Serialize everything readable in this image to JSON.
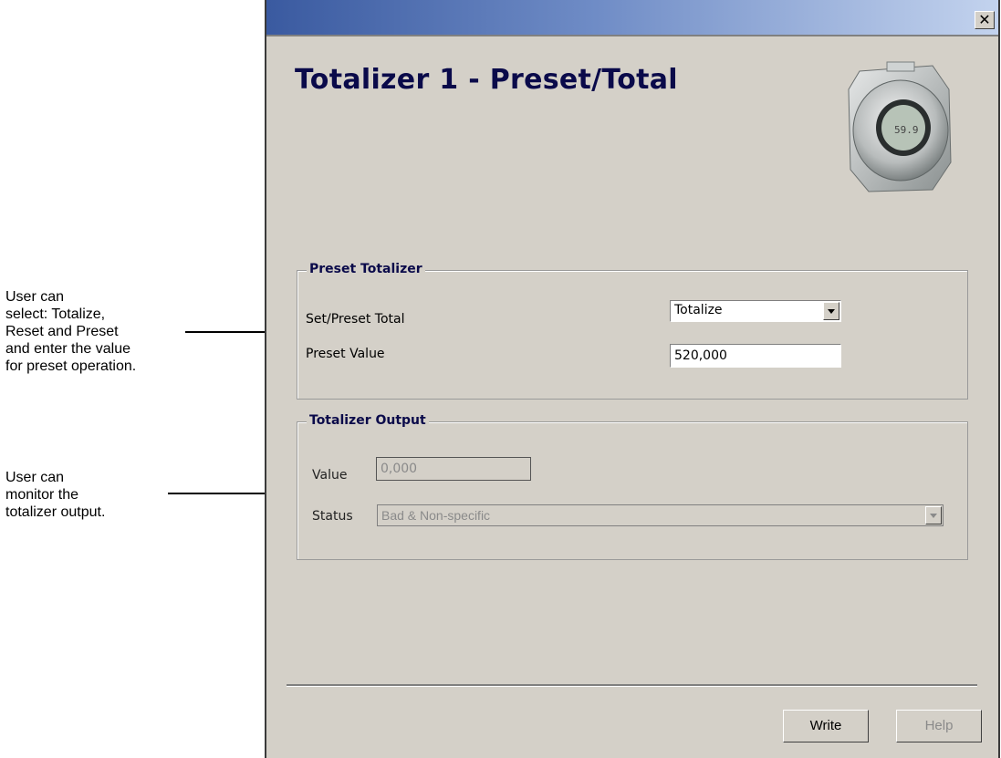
{
  "annotations": {
    "preset_note": [
      "User can",
      "select: Totalize,",
      "Reset and Preset",
      "and enter the value",
      "for preset operation."
    ],
    "output_note": [
      "User can",
      "monitor the",
      "totalizer output."
    ]
  },
  "window": {
    "close_glyph": "✕",
    "title": "Totalizer 1 - Preset/Total",
    "device_display_text": "59.9"
  },
  "preset_group": {
    "title": "Preset Totalizer",
    "set_label": "Set/Preset Total",
    "set_value": "Totalize",
    "preset_label": "Preset Value",
    "preset_value": "520,000"
  },
  "output_group": {
    "title": "Totalizer Output",
    "value_label": "Value",
    "value": "0,000",
    "status_label": "Status",
    "status_value": "Bad & Non-specific"
  },
  "buttons": {
    "write": "Write",
    "help": "Help"
  }
}
